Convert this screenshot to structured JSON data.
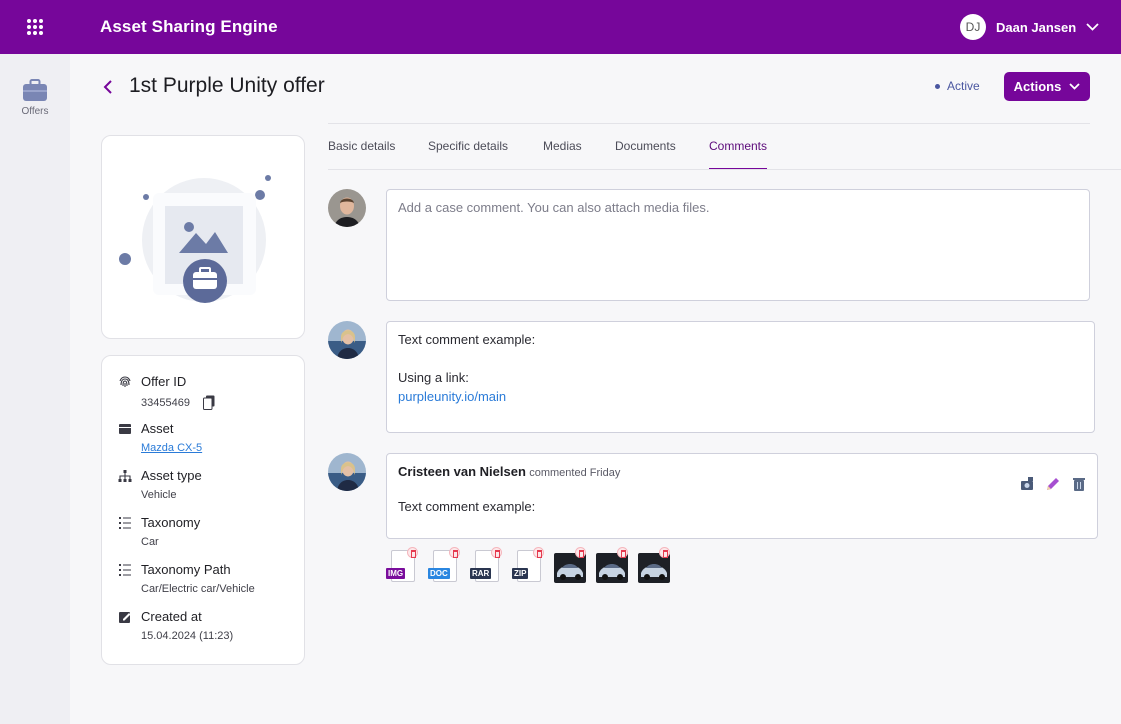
{
  "app": {
    "title": "Asset Sharing Engine"
  },
  "user": {
    "initials": "DJ",
    "name": "Daan Jansen"
  },
  "sidebar": {
    "items": [
      {
        "label": "Offers",
        "icon": "briefcase-icon"
      }
    ]
  },
  "page": {
    "title": "1st Purple Unity offer",
    "status": "Active",
    "actions_label": "Actions"
  },
  "tabs": [
    {
      "label": "Basic details",
      "active": false
    },
    {
      "label": "Specific details",
      "active": false
    },
    {
      "label": "Medias",
      "active": false
    },
    {
      "label": "Documents",
      "active": false
    },
    {
      "label": "Comments",
      "active": true
    }
  ],
  "details": [
    {
      "label": "Offer ID",
      "value": "33455469",
      "icon": "fingerprint-icon",
      "copyable": true
    },
    {
      "label": "Asset",
      "value": "Mazda CX-5",
      "icon": "asset-icon",
      "link": true
    },
    {
      "label": "Asset type",
      "value": "Vehicle",
      "icon": "hierarchy-icon"
    },
    {
      "label": "Taxonomy",
      "value": "Car",
      "icon": "list-icon"
    },
    {
      "label": "Taxonomy Path",
      "value": "Car/Electric car/Vehicle",
      "icon": "list-icon"
    },
    {
      "label": "Created at",
      "value": "15.04.2024 (11:23)",
      "icon": "edit-note-icon"
    }
  ],
  "comments": {
    "new_placeholder": "Add a case comment. You can also attach media files.",
    "items": [
      {
        "line1": "Text comment example:",
        "line2": "Using a link:",
        "link": "purpleunity.io/main"
      },
      {
        "author": "Cristeen van Nielsen",
        "meta": "commented Friday",
        "text": "Text comment example:"
      }
    ],
    "attachments": [
      {
        "type": "file",
        "label": "IMG",
        "color": "#7a0d9c"
      },
      {
        "type": "file",
        "label": "DOC",
        "color": "#2a86e0"
      },
      {
        "type": "file",
        "label": "RAR",
        "color": "#2a3550"
      },
      {
        "type": "file",
        "label": "ZIP",
        "color": "#2a3550"
      },
      {
        "type": "image"
      },
      {
        "type": "image"
      },
      {
        "type": "image"
      }
    ]
  },
  "colors": {
    "brand": "#76069a",
    "link": "#2a7bd8",
    "status": "#4a56a0"
  }
}
